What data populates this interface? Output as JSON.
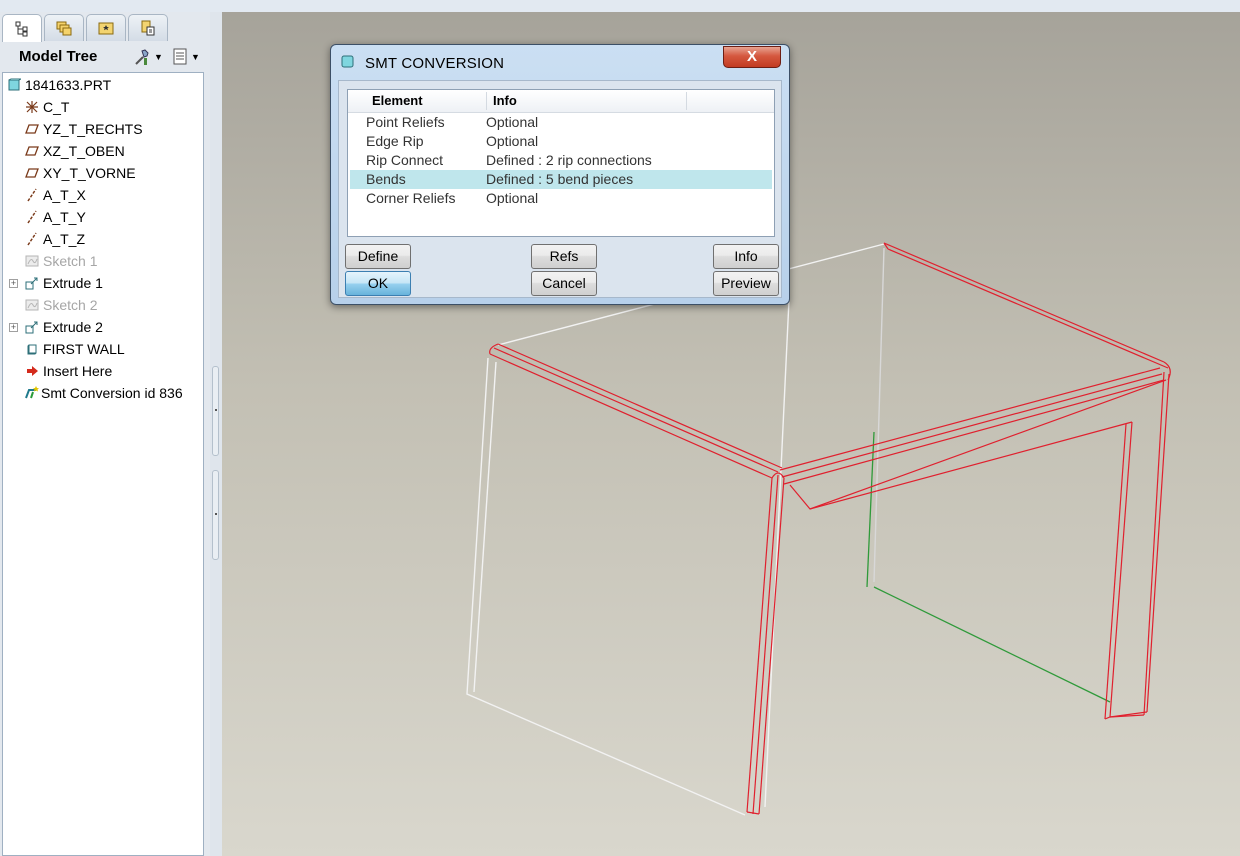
{
  "left_panel": {
    "tabs": [
      {
        "icon": "model-tree-icon"
      },
      {
        "icon": "layers-icon"
      },
      {
        "icon": "folder-icon"
      },
      {
        "icon": "favorites-icon"
      }
    ],
    "header_title": "Model Tree",
    "tools": [
      {
        "icon": "settings-tool-icon"
      },
      {
        "icon": "show-options-icon"
      }
    ]
  },
  "model_tree": {
    "nodes": [
      {
        "label": "1841633.PRT",
        "icon": "part-icon"
      },
      {
        "label": "C_T",
        "icon": "coordinate-system-icon"
      },
      {
        "label": "YZ_T_RECHTS",
        "icon": "datum-plane-icon"
      },
      {
        "label": "XZ_T_OBEN",
        "icon": "datum-plane-icon"
      },
      {
        "label": "XY_T_VORNE",
        "icon": "datum-plane-icon"
      },
      {
        "label": "A_T_X",
        "icon": "datum-axis-icon"
      },
      {
        "label": "A_T_Y",
        "icon": "datum-axis-icon"
      },
      {
        "label": "A_T_Z",
        "icon": "datum-axis-icon"
      },
      {
        "label": "Sketch 1",
        "icon": "sketch-icon"
      },
      {
        "label": "Extrude 1",
        "icon": "extrude-icon"
      },
      {
        "label": "Sketch 2",
        "icon": "sketch-icon"
      },
      {
        "label": "Extrude 2",
        "icon": "extrude-icon"
      },
      {
        "label": "FIRST WALL",
        "icon": "first-wall-icon"
      },
      {
        "label": "Insert Here",
        "icon": "insert-arrow-icon"
      },
      {
        "label": "Smt Conversion id 836",
        "icon": "smt-conversion-icon"
      }
    ]
  },
  "dialog": {
    "title": "SMT CONVERSION",
    "close_label": "X",
    "columns": [
      "Element",
      "Info"
    ],
    "rows": [
      {
        "element": "Point Reliefs",
        "info": "Optional"
      },
      {
        "element": "Edge Rip",
        "info": "Optional"
      },
      {
        "element": "Rip Connect",
        "info": "Defined : 2 rip connections"
      },
      {
        "element": "Bends",
        "info": "Defined : 5 bend pieces",
        "selected": true
      },
      {
        "element": "Corner Reliefs",
        "info": "Optional"
      }
    ],
    "buttons": {
      "define": "Define",
      "refs": "Refs",
      "info": "Info",
      "ok": "OK",
      "cancel": "Cancel",
      "preview": "Preview"
    }
  },
  "colors": {
    "bend_edges": "#e0202e",
    "wire_edges": "#f2f2f2",
    "reference_edge": "#2f9a3a",
    "selected_row": "#bfe6ec"
  }
}
